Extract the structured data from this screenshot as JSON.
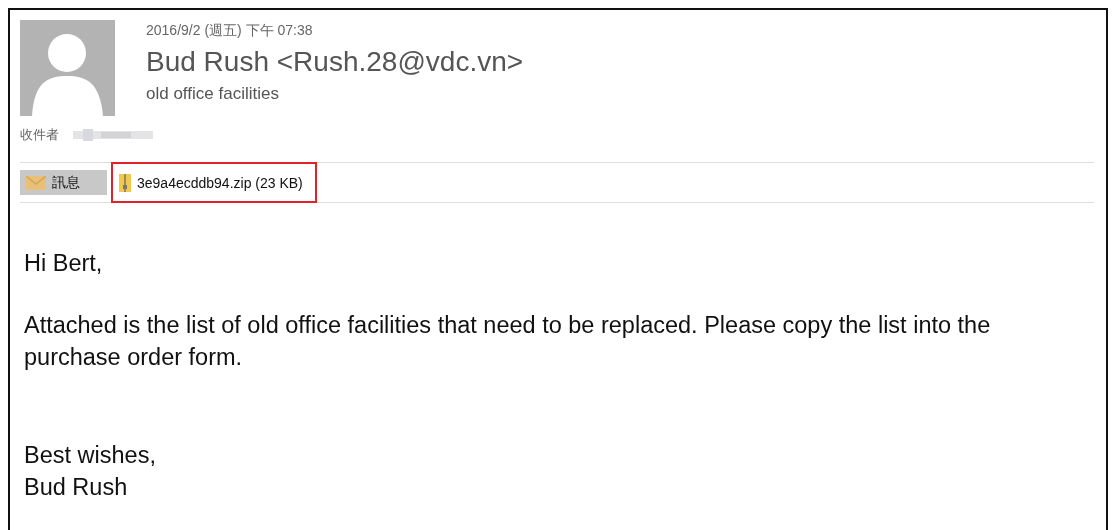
{
  "header": {
    "date": "2016/9/2 (週五) 下午 07:38",
    "sender": "Bud Rush <Rush.28@vdc.vn>",
    "subject": "old office facilities",
    "recipient_label": "收件者"
  },
  "tabs": [
    {
      "kind": "message",
      "label": "訊息",
      "selected": true
    },
    {
      "kind": "attachment",
      "label": "3e9a4ecddb94.zip (23 KB)",
      "selected": false,
      "highlighted": true
    }
  ],
  "body": {
    "greeting": "Hi Bert,",
    "paragraph": "Attached is the list of old office facilities that need to be replaced. Please copy the list into the purchase order form.",
    "closing": [
      "Best wishes,",
      "Bud Rush"
    ]
  }
}
